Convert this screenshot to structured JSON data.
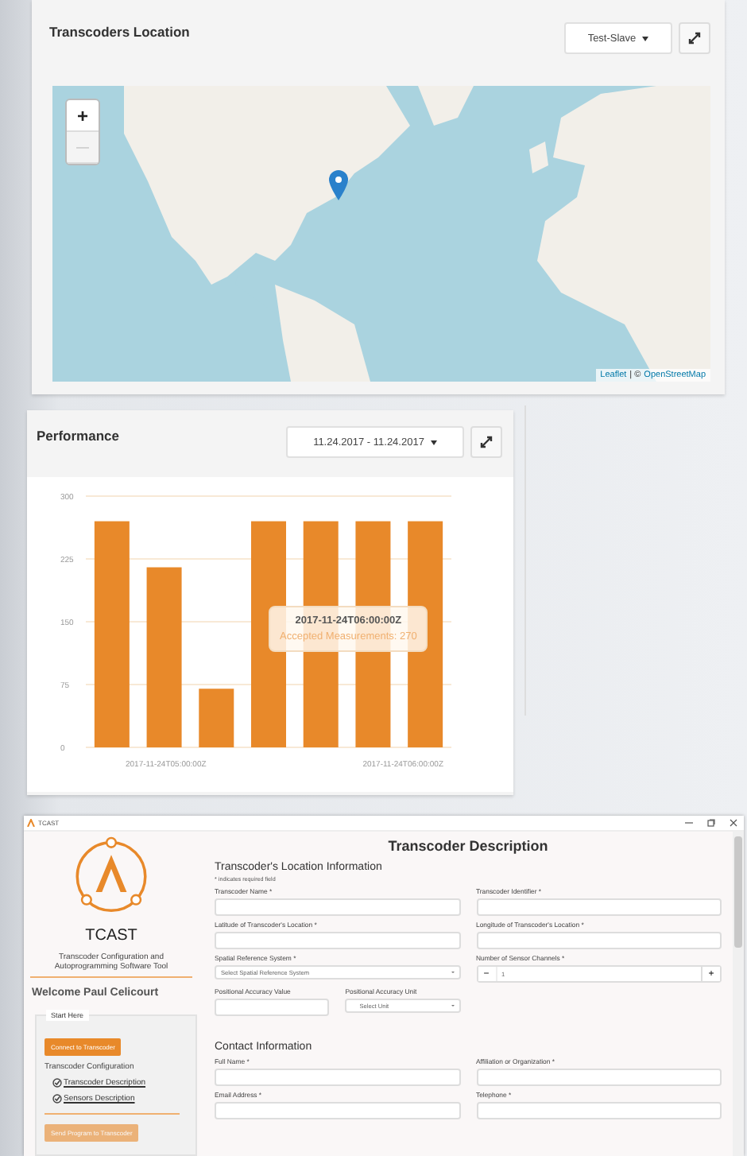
{
  "location_card": {
    "title": "Transcoders Location",
    "dropdown": "Test-Slave",
    "map": {
      "zoom_in": "+",
      "zoom_out": "—",
      "attribution": {
        "links": [
          "Leaflet",
          "OpenStreetMap"
        ],
        "separator": "| ©"
      }
    }
  },
  "performance_card": {
    "title": "Performance",
    "dropdown": "11.24.2017 - 11.24.2017",
    "chart_data": {
      "type": "bar",
      "values": [
        270,
        215,
        70,
        270,
        270,
        270,
        270
      ],
      "ylim": [
        0,
        300
      ],
      "yticks": [
        0,
        75,
        150,
        225,
        300
      ],
      "grid": true
    },
    "x_labels": [
      "2017-11-24T05:00:00Z",
      "2017-11-24T06:00:00Z"
    ],
    "tooltip": {
      "title": "2017-11-24T06:00:00Z",
      "text": "Accepted Measurements: 270"
    }
  },
  "app_window": {
    "title": "TCAST",
    "sidebar": {
      "app_name": "TCAST",
      "subtitle": "Transcoder Configuration and Autoprogramming Software Tool",
      "welcome": "Welcome Paul Celicourt",
      "group_label": "Start Here",
      "items": [
        {
          "kind": "button",
          "label": "Connect to Transcoder",
          "disabled": false
        },
        {
          "kind": "heading",
          "label": "Transcoder Configuration"
        },
        {
          "kind": "link",
          "label": "Transcoder Description",
          "checked": true
        },
        {
          "kind": "link",
          "label": "Sensors Description",
          "checked": true
        },
        {
          "kind": "divider"
        },
        {
          "kind": "button",
          "label": "Send Program to Transcoder",
          "disabled": true
        }
      ]
    },
    "form": {
      "title": "Transcoder Description",
      "sections": [
        {
          "heading": "Transcoder's Location Information",
          "note": "* indicates required field",
          "rows": [
            [
              {
                "kind": "text",
                "label": "Transcoder Name *"
              },
              {
                "kind": "text",
                "label": "Transcoder Identifier *"
              }
            ],
            [
              {
                "kind": "text",
                "label": "Latitude of Transcoder's Location *"
              },
              {
                "kind": "text",
                "label": "Longitude of Transcoder's Location *"
              }
            ],
            [
              {
                "kind": "select",
                "label": "Spatial Reference System *",
                "value": "Select Spatial Reference System"
              },
              {
                "kind": "stepper",
                "label": "Number of Sensor Channels *",
                "value": "1",
                "minus": "−",
                "plus": "+"
              }
            ],
            [
              {
                "kind": "pair",
                "fields": [
                  {
                    "kind": "text",
                    "label": "Positional Accuracy Value"
                  },
                  {
                    "kind": "select",
                    "label": "Positional Accuracy Unit",
                    "value": "Select Unit"
                  }
                ]
              }
            ]
          ]
        },
        {
          "heading": "Contact Information",
          "rows": [
            [
              {
                "kind": "text",
                "label": "Full Name *"
              },
              {
                "kind": "text",
                "label": "Affiliation or Organization *"
              }
            ],
            [
              {
                "kind": "text",
                "label": "Email Address *"
              },
              {
                "kind": "text",
                "label": "Telephone *"
              }
            ]
          ]
        }
      ]
    }
  }
}
